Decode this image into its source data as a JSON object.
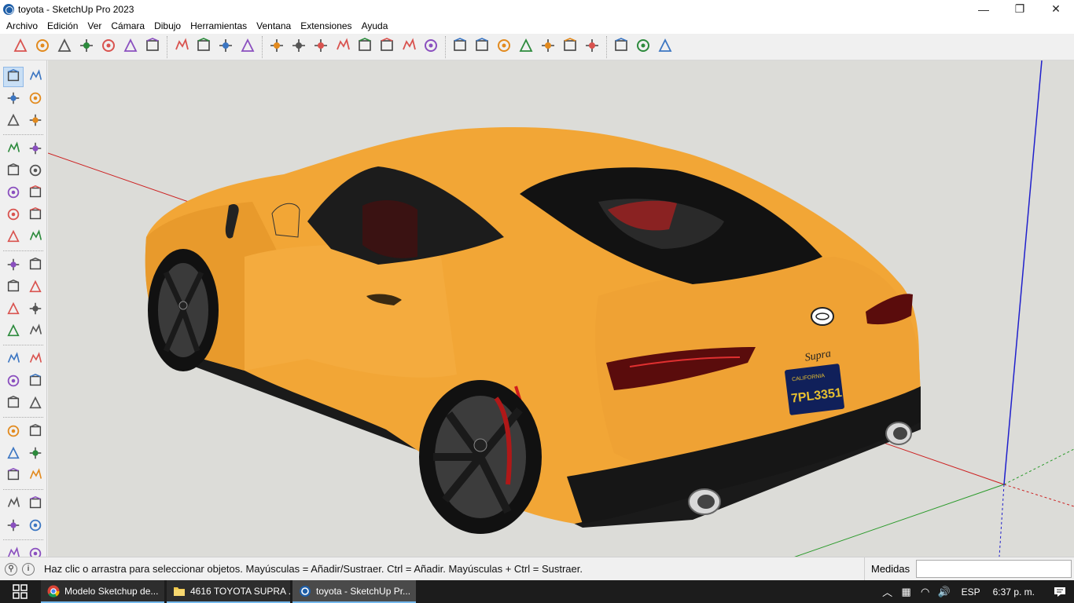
{
  "window": {
    "title": "toyota - SketchUp Pro 2023",
    "minimize_glyph": "—",
    "maximize_glyph": "❐",
    "close_glyph": "✕"
  },
  "menu": {
    "items": [
      "Archivo",
      "Edición",
      "Ver",
      "Cámara",
      "Dibujo",
      "Herramientas",
      "Ventana",
      "Extensiones",
      "Ayuda"
    ]
  },
  "toolbar": {
    "groups": [
      [
        "styles-icon",
        "paint-icon",
        "teapot-icon",
        "teapot-play-icon",
        "orbit-icon",
        "scenes-icon",
        "refresh-icon"
      ],
      [
        "layout-icon",
        "window-icon",
        "box-icon",
        "lock-icon"
      ],
      [
        "house-icon",
        "pushpull-icon",
        "circle-icon",
        "protractor-icon",
        "tape-icon",
        "sun-icon",
        "shadow-icon",
        "sphere-icon"
      ],
      [
        "warehouse-icon",
        "cube-icon",
        "cube-plus-icon",
        "grass-icon",
        "ruler-icon",
        "grid-icon",
        "edit-icon"
      ],
      [
        "tiles-icon",
        "tiles-stack-icon",
        "extension-icon"
      ]
    ]
  },
  "left_tools": [
    [
      "select-tool-icon",
      "orbit-tool-icon"
    ],
    [
      "paint-bucket-icon",
      "eraser-icon"
    ],
    [
      "component-icon",
      "tag-icon"
    ],
    "sep",
    [
      "pencil-line-icon",
      "freehand-icon"
    ],
    [
      "rectangle-icon",
      "rotated-rectangle-icon"
    ],
    [
      "circle-tool-icon",
      "polygon-icon"
    ],
    [
      "arc-icon",
      "two-point-arc-icon"
    ],
    [
      "three-point-arc-icon",
      "pie-icon"
    ],
    "sep",
    [
      "move-icon",
      "push-pull-tool-icon"
    ],
    [
      "rotate-icon",
      "follow-me-icon"
    ],
    [
      "scale-icon",
      "offset-icon"
    ],
    [
      "axes-tool-icon",
      "solid-tools-icon"
    ],
    "sep",
    [
      "tape-measure-icon",
      "dimension-icon"
    ],
    [
      "protractor-tool-icon",
      "text-icon"
    ],
    [
      "axes-icon",
      "3d-text-icon"
    ],
    "sep",
    [
      "orbit-nav-icon",
      "pan-icon"
    ],
    [
      "zoom-icon",
      "zoom-window-icon"
    ],
    [
      "zoom-extents-icon",
      "search-icon"
    ],
    "sep",
    [
      "position-camera-icon",
      "walk-icon"
    ],
    [
      "look-around-icon",
      "section-icon"
    ],
    "sep",
    [
      "sandbox-icon",
      "fly-icon"
    ]
  ],
  "status": {
    "hint": "Haz clic o arrastra para seleccionar objetos. Mayúsculas = Añadir/Sustraer. Ctrl = Añadir. Mayúsculas + Ctrl = Sustraer.",
    "measure_label": "Medidas",
    "measure_value": "",
    "geo_glyph": "⚲",
    "info_glyph": "i"
  },
  "scene": {
    "plate": "7PL3351",
    "plate_state": "CALIFORNIA",
    "badge": "Supra"
  },
  "taskbar": {
    "items": [
      {
        "label": "Modelo Sketchup de...",
        "icon": "chrome-icon",
        "active": false
      },
      {
        "label": "4616 TOYOTA SUPRA ...",
        "icon": "folder-icon",
        "active": false
      },
      {
        "label": "toyota - SketchUp Pr...",
        "icon": "sketchup-icon",
        "active": true
      }
    ],
    "tray": {
      "chevron": "︿",
      "network": "▦",
      "wifi": "◠",
      "volume": "🔊",
      "lang": "ESP",
      "clock": "6:37 p. m."
    }
  },
  "colors": {
    "car_body": "#f2a636",
    "car_shadow": "#d98d22",
    "viewport_bg": "#dcdcd8",
    "axis_red": "#cc2020",
    "axis_green": "#2a9a2a",
    "axis_blue": "#2020cc"
  }
}
